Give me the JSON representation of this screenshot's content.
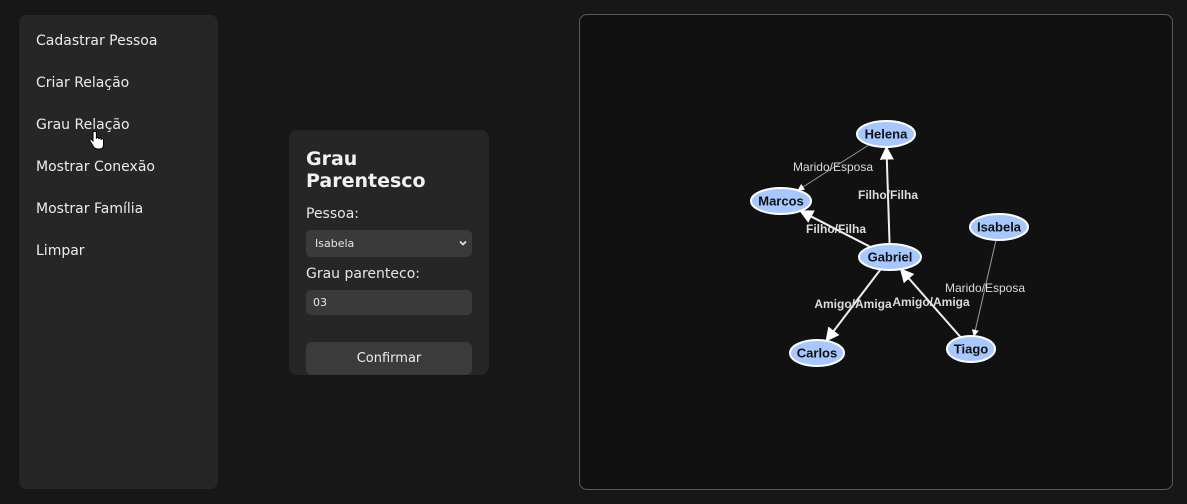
{
  "sidebar": {
    "items": [
      {
        "label": "Cadastrar Pessoa"
      },
      {
        "label": "Criar Relação"
      },
      {
        "label": "Grau Relação"
      },
      {
        "label": "Mostrar Conexão"
      },
      {
        "label": "Mostrar Família"
      },
      {
        "label": "Limpar"
      }
    ]
  },
  "panel": {
    "title": "Grau Parentesco",
    "person_label": "Pessoa:",
    "person_selected": "Isabela",
    "degree_label": "Grau parenteco:",
    "degree_value": "03",
    "confirm_label": "Confirmar"
  },
  "graph": {
    "node_color": "#a7c7ff",
    "nodes": [
      {
        "id": "helena",
        "label": "Helena"
      },
      {
        "id": "marcos",
        "label": "Marcos"
      },
      {
        "id": "isabela",
        "label": "Isabela"
      },
      {
        "id": "gabriel",
        "label": "Gabriel"
      },
      {
        "id": "carlos",
        "label": "Carlos"
      },
      {
        "id": "tiago",
        "label": "Tiago"
      }
    ],
    "edges": [
      {
        "from": "helena",
        "to": "marcos",
        "label": "Marido/Esposa"
      },
      {
        "from": "gabriel",
        "to": "helena",
        "label": "Filho/Filha"
      },
      {
        "from": "gabriel",
        "to": "marcos",
        "label": "Filho/Filha"
      },
      {
        "from": "isabela",
        "to": "tiago",
        "label": "Marido/Esposa"
      },
      {
        "from": "gabriel",
        "to": "carlos",
        "label": "Amigo/Amiga"
      },
      {
        "from": "tiago",
        "to": "gabriel",
        "label": "Amigo/Amiga"
      }
    ]
  }
}
